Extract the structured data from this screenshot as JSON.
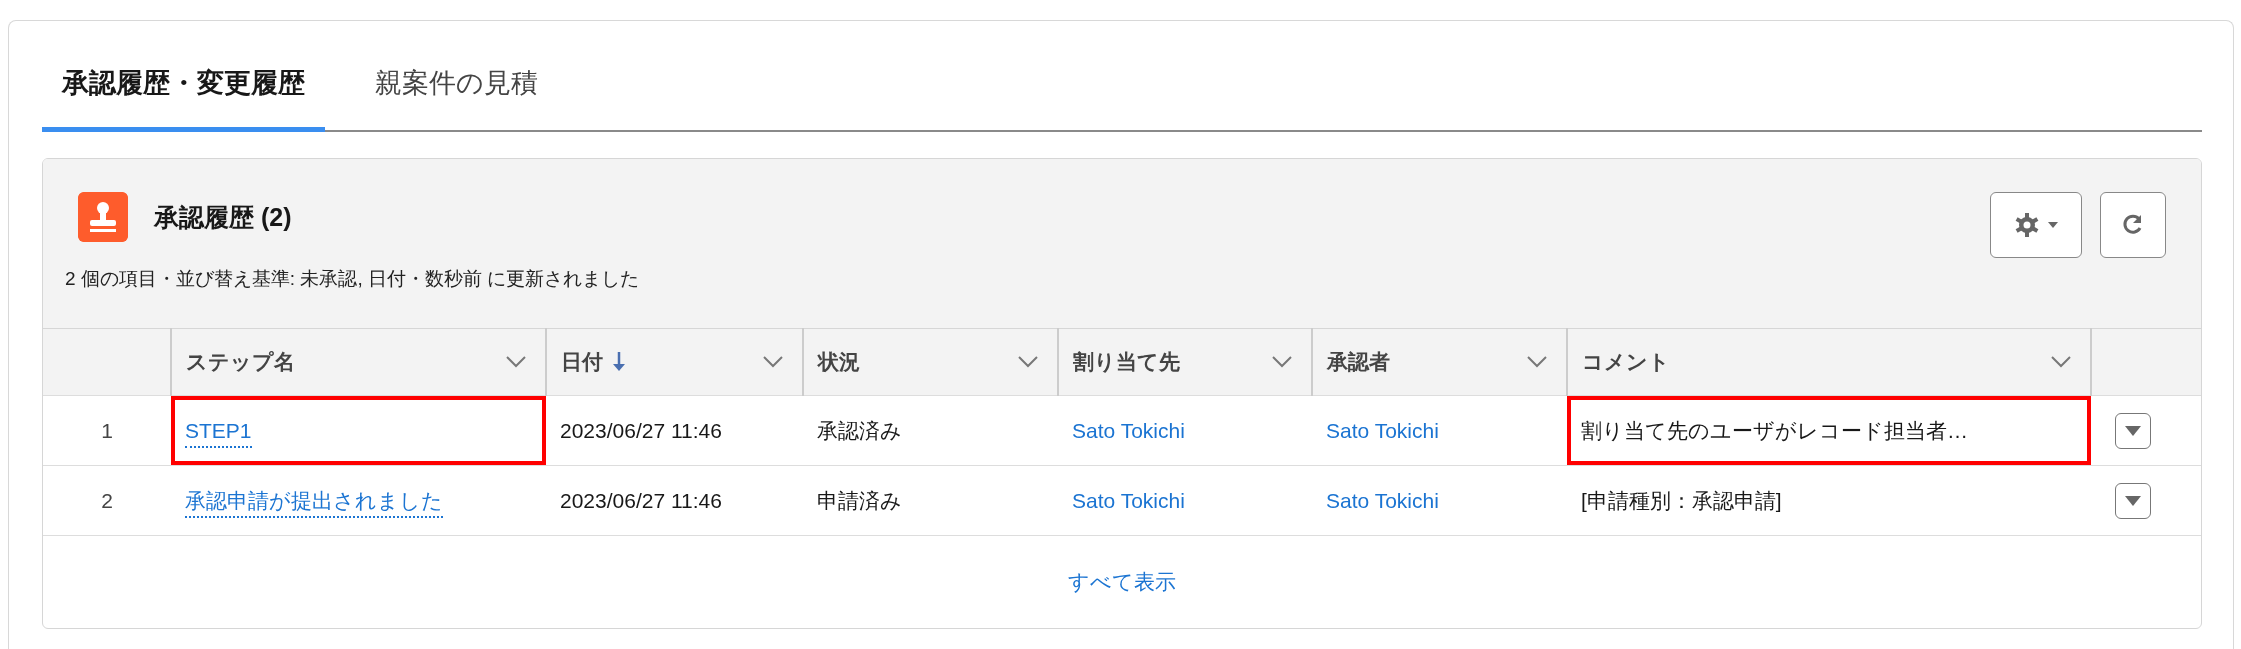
{
  "tabs": [
    {
      "label": "承認履歴・変更履歴",
      "selected": true
    },
    {
      "label": "親案件の見積",
      "selected": false
    }
  ],
  "card": {
    "title": "承認履歴 (2)",
    "subtitle": "2 個の項目・並び替え基準: 未承認, 日付・数秒前 に更新されました",
    "columns": [
      {
        "label": "ステップ名",
        "kind": "link",
        "sorted": false
      },
      {
        "label": "日付",
        "kind": "text",
        "sorted": true
      },
      {
        "label": "状況",
        "kind": "text",
        "sorted": false
      },
      {
        "label": "割り当て先",
        "kind": "name",
        "sorted": false
      },
      {
        "label": "承認者",
        "kind": "name",
        "sorted": false
      },
      {
        "label": "コメント",
        "kind": "text",
        "sorted": false
      }
    ],
    "rows": [
      {
        "number": "1",
        "cells": [
          {
            "text": "STEP1",
            "highlighted": true
          },
          {
            "text": "2023/06/27 11:46",
            "highlighted": false
          },
          {
            "text": "承認済み",
            "highlighted": false
          },
          {
            "text": "Sato Tokichi",
            "highlighted": false
          },
          {
            "text": "Sato Tokichi",
            "highlighted": false
          },
          {
            "text": "割り当て先のユーザがレコード担当者…",
            "highlighted": true
          }
        ]
      },
      {
        "number": "2",
        "cells": [
          {
            "text": "承認申請が提出されました",
            "highlighted": false
          },
          {
            "text": "2023/06/27 11:46",
            "highlighted": false
          },
          {
            "text": "申請済み",
            "highlighted": false
          },
          {
            "text": "Sato Tokichi",
            "highlighted": false
          },
          {
            "text": "Sato Tokichi",
            "highlighted": false
          },
          {
            "text": "[申請種別：承認申請]",
            "highlighted": false
          }
        ]
      }
    ],
    "footer_link": "すべて表示"
  }
}
